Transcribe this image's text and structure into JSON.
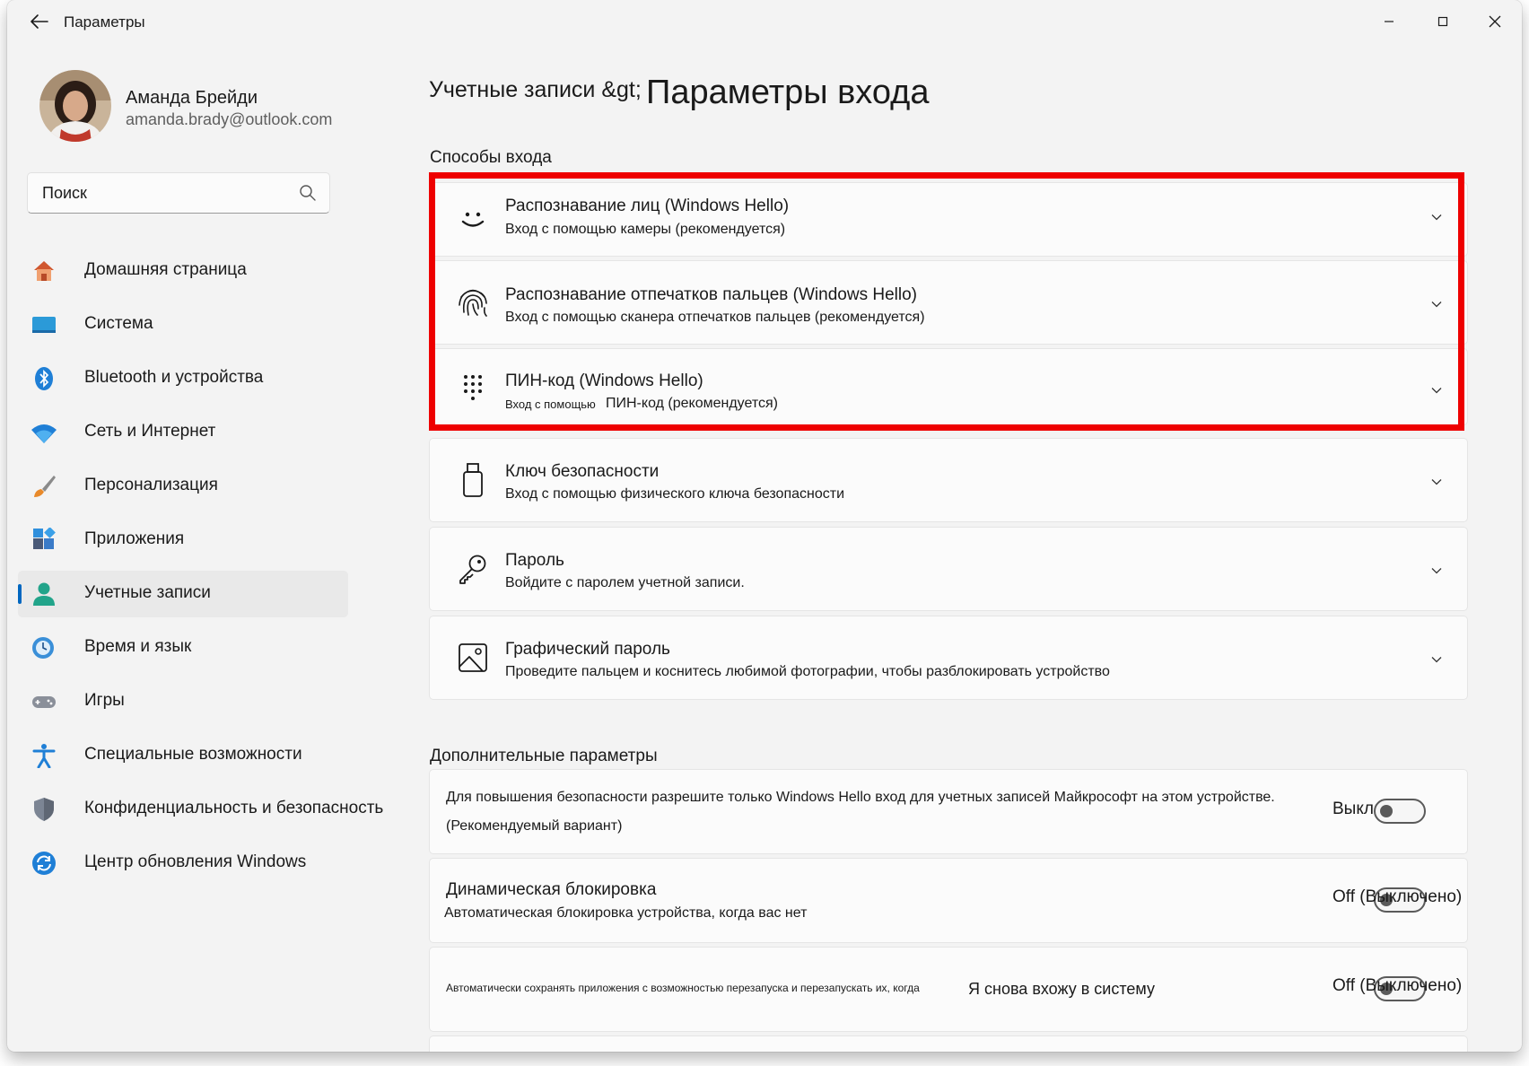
{
  "app": {
    "title": "Параметры"
  },
  "profile": {
    "name": "Аманда Брейди",
    "email": "amanda.brady@outlook.com"
  },
  "search": {
    "placeholder": "Поиск"
  },
  "nav": {
    "items": [
      {
        "label": "Домашняя страница",
        "icon": "home-icon"
      },
      {
        "label": "Система",
        "icon": "system-icon"
      },
      {
        "label": "Bluetooth и устройства",
        "icon": "bluetooth-icon"
      },
      {
        "label": "Сеть и Интернет",
        "icon": "wifi-icon"
      },
      {
        "label": "Персонализация",
        "icon": "brush-icon"
      },
      {
        "label": "Приложения",
        "icon": "apps-icon"
      },
      {
        "label": "Учетные записи",
        "icon": "accounts-icon",
        "selected": true
      },
      {
        "label": "Время и язык",
        "icon": "time-language-icon"
      },
      {
        "label": "Игры",
        "icon": "gaming-icon"
      },
      {
        "label": "Специальные возможности",
        "icon": "accessibility-icon"
      },
      {
        "label": "Конфиденциальность и безопасность",
        "icon": "shield-icon"
      },
      {
        "label": "Центр обновления Windows",
        "icon": "update-icon"
      }
    ]
  },
  "main": {
    "breadcrumb_parent": "Учетные записи &gt;",
    "page_title": "Параметры входа",
    "signin_section": "Способы входа",
    "signin_options": [
      {
        "title": "Распознавание лиц (Windows Hello)",
        "subtitle": "Вход с помощью камеры (рекомендуется)",
        "icon": "face-icon"
      },
      {
        "title": "Распознавание отпечатков пальцев (Windows Hello)",
        "subtitle": "Вход с помощью сканера отпечатков пальцев (рекомендуется)",
        "icon": "fingerprint-icon"
      },
      {
        "title": "ПИН-код (Windows Hello)",
        "subtitle_small": "Вход с помощью",
        "subtitle": "ПИН-код (рекомендуется)",
        "icon": "pin-keypad-icon"
      },
      {
        "title": "Ключ безопасности",
        "subtitle": "Вход с помощью физического ключа безопасности",
        "icon": "usb-key-icon"
      },
      {
        "title": "Пароль",
        "subtitle": "Войдите с паролем учетной записи.",
        "icon": "key-icon"
      },
      {
        "title": "Графический пароль",
        "subtitle": "Проведите пальцем и коснитесь любимой фотографии, чтобы разблокировать устройство",
        "icon": "picture-icon"
      }
    ],
    "additional_section": "Дополнительные параметры",
    "additional": [
      {
        "line1": "Для повышения безопасности разрешите только Windows Hello вход для учетных записей Майкрософт на этом устройстве.",
        "line2": "(Рекомендуемый вариант)",
        "toggle_label": "Выкл.",
        "toggle_on": false
      },
      {
        "title": "Динамическая блокировка",
        "subtitle": "Автоматическая блокировка устройства, когда вас нет",
        "toggle_label": "Off (Выключено)",
        "toggle_on": false
      },
      {
        "text_small": "Автоматически сохранять приложения с возможностью перезапуска и перезапускать их, когда",
        "text": "Я снова вхожу в систему",
        "toggle_label": "Off (Выключено)",
        "toggle_on": false
      }
    ]
  },
  "colors": {
    "accent": "#0067c0",
    "highlight": "#ee0000",
    "window_bg": "#f3f3f3",
    "card_bg": "#fbfbfb"
  }
}
